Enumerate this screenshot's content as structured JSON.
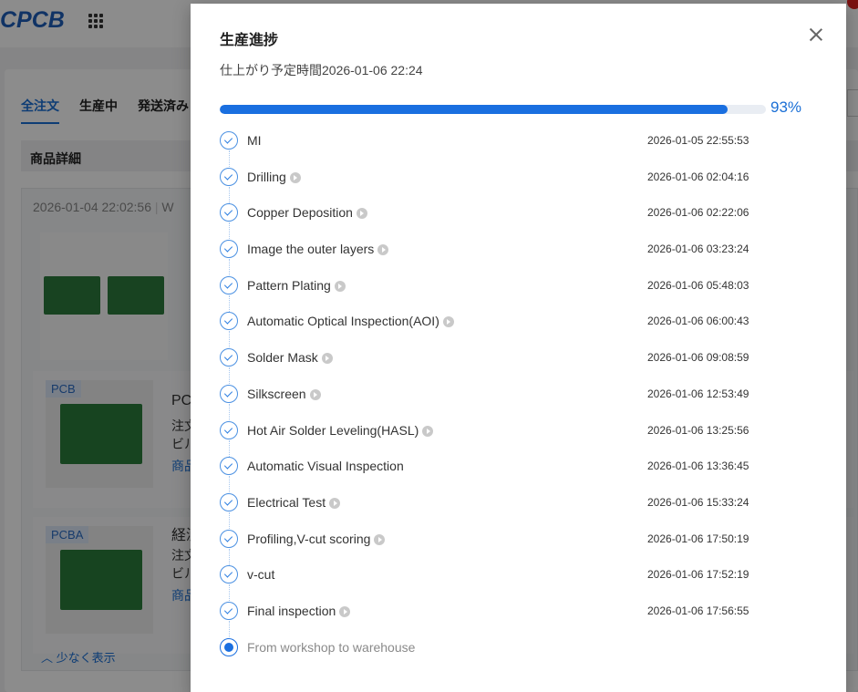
{
  "app": {
    "logo_text": "CPCB",
    "tabs": [
      {
        "label": "全注文",
        "active": true
      },
      {
        "label": "生産中",
        "active": false
      },
      {
        "label": "発送済み",
        "active": false
      }
    ],
    "table_header": "商品詳細",
    "order": {
      "date": "2026-01-04 22:02:56",
      "date_suffix": "W",
      "items": [
        {
          "tag": "PCB",
          "title": "PC",
          "line1": "注文",
          "line2": "ビル",
          "link": "商品"
        },
        {
          "tag": "PCBA",
          "title": "経済",
          "line1": "注文",
          "line2": "ビル",
          "link": "商品"
        }
      ],
      "show_less": "少なく表示"
    }
  },
  "modal": {
    "title": "生産進捗",
    "eta_label": "仕上がり予定時間",
    "eta_value": "2026-01-06 22:24",
    "progress_percent": 93,
    "progress_text": "93%",
    "colors": {
      "accent": "#1a6fe0",
      "track": "#e9edf3"
    },
    "steps": [
      {
        "name": "MI",
        "time": "2026-01-05 22:55:53",
        "video": false,
        "status": "done"
      },
      {
        "name": "Drilling",
        "time": "2026-01-06 02:04:16",
        "video": true,
        "status": "done"
      },
      {
        "name": "Copper Deposition",
        "time": "2026-01-06 02:22:06",
        "video": true,
        "status": "done"
      },
      {
        "name": "Image the outer layers",
        "time": "2026-01-06 03:23:24",
        "video": true,
        "status": "done"
      },
      {
        "name": "Pattern Plating",
        "time": "2026-01-06 05:48:03",
        "video": true,
        "status": "done"
      },
      {
        "name": "Automatic Optical Inspection(AOI)",
        "time": "2026-01-06 06:00:43",
        "video": true,
        "status": "done"
      },
      {
        "name": "Solder Mask",
        "time": "2026-01-06 09:08:59",
        "video": true,
        "status": "done"
      },
      {
        "name": "Silkscreen",
        "time": "2026-01-06 12:53:49",
        "video": true,
        "status": "done"
      },
      {
        "name": "Hot Air Solder Leveling(HASL)",
        "time": "2026-01-06 13:25:56",
        "video": true,
        "status": "done"
      },
      {
        "name": "Automatic Visual Inspection",
        "time": "2026-01-06 13:36:45",
        "video": false,
        "status": "done"
      },
      {
        "name": "Electrical Test",
        "time": "2026-01-06 15:33:24",
        "video": true,
        "status": "done"
      },
      {
        "name": "Profiling,V-cut scoring",
        "time": "2026-01-06 17:50:19",
        "video": true,
        "status": "done"
      },
      {
        "name": "v-cut",
        "time": "2026-01-06 17:52:19",
        "video": false,
        "status": "done"
      },
      {
        "name": "Final inspection",
        "time": "2026-01-06 17:56:55",
        "video": true,
        "status": "done"
      },
      {
        "name": "From workshop to warehouse",
        "time": "",
        "video": false,
        "status": "current"
      }
    ]
  }
}
